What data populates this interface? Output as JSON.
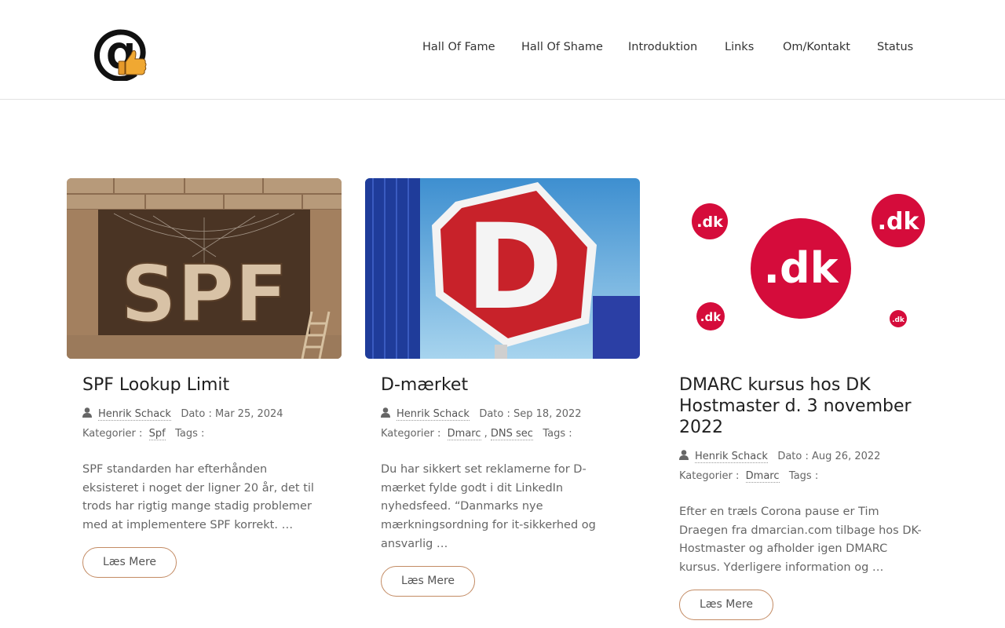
{
  "nav": {
    "items": [
      "Hall Of Fame",
      "Hall Of Shame",
      "Introduktion",
      "Links",
      "Om/Kontakt",
      "Status"
    ]
  },
  "meta_labels": {
    "date_prefix": "Dato :",
    "categories_prefix": "Kategorier :",
    "tags_prefix": "Tags :",
    "read_more": "Læs Mere"
  },
  "posts": [
    {
      "title": "SPF Lookup Limit",
      "author": "Henrik Schack",
      "date": "Mar 25, 2024",
      "categories": [
        "Spf"
      ],
      "excerpt": "SPF standarden har efterhånden eksisteret i noget der ligner 20 år, det til trods har rigtig mange stadig problemer med at implementere SPF korrekt. …"
    },
    {
      "title": "D-mærket",
      "author": "Henrik Schack",
      "date": "Sep 18, 2022",
      "categories": [
        "Dmarc",
        "DNS sec"
      ],
      "excerpt": "Du har sikkert set reklamerne for D-mærket fylde godt i dit LinkedIn nyhedsfeed. “Danmarks nye mærkningsordning for it-sikkerhed og ansvarlig …"
    },
    {
      "title": "DMARC kursus hos DK Hostmaster d. 3 november 2022",
      "author": "Henrik Schack",
      "date": "Aug 26, 2022",
      "categories": [
        "Dmarc"
      ],
      "excerpt": "Efter en træls Corona pause er Tim Draegen fra dmarcian.com tilbage hos DK-Hostmaster og afholder igen DMARC kursus. Yderligere information og …"
    }
  ],
  "thumbs": {
    "spf_text": "SPF",
    "d_text": "D",
    "dk_text": ".dk"
  },
  "colors": {
    "accent_border": "#c38b64",
    "dk_red": "#d50c3b",
    "d_sign_red": "#c8222a"
  }
}
